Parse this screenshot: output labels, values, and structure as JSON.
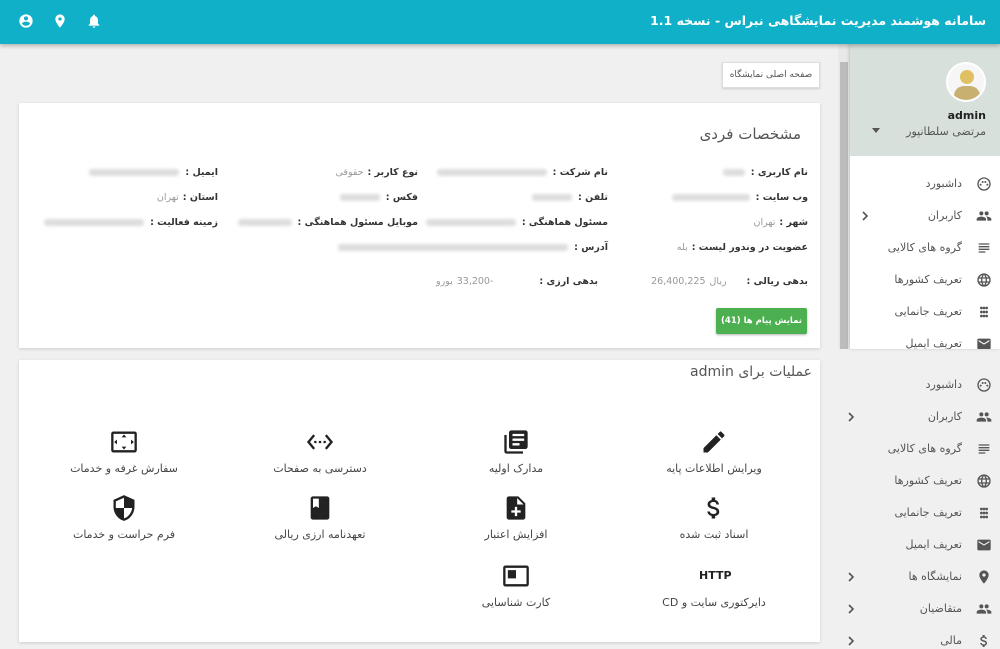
{
  "app": {
    "title": "سامانه هوشمند مدیریت نمایشگاهی نبراس - نسخه 1.1",
    "icons": [
      "account-circle-icon",
      "location-pin-icon",
      "bell-icon"
    ]
  },
  "profile": {
    "username": "admin",
    "fullname": "مرتضی سلطانپور"
  },
  "sidebar": {
    "items": [
      {
        "label": "داشبورد",
        "icon": "dashboard-icon"
      },
      {
        "label": "کاربران",
        "icon": "users-icon",
        "expandable": true
      },
      {
        "label": "گروه های کالایی",
        "icon": "list-icon"
      },
      {
        "label": "تعریف کشورها",
        "icon": "globe-icon"
      },
      {
        "label": "تعریف جانمایی",
        "icon": "grid-icon"
      },
      {
        "label": "تعریف ایمیل",
        "icon": "mail-icon"
      }
    ]
  },
  "sidebar2": {
    "items": [
      {
        "label": "داشبورد",
        "icon": "dashboard-icon"
      },
      {
        "label": "کاربران",
        "icon": "users-icon",
        "expandable": true
      },
      {
        "label": "گروه های کالایی",
        "icon": "list-icon"
      },
      {
        "label": "تعریف کشورها",
        "icon": "globe-icon"
      },
      {
        "label": "تعریف جانمایی",
        "icon": "grid-icon"
      },
      {
        "label": "تعریف ایمیل",
        "icon": "mail-icon"
      },
      {
        "label": "نمایشگاه ها",
        "icon": "location-pin-icon",
        "expandable": true
      },
      {
        "label": "متقاضیان",
        "icon": "users-icon",
        "expandable": true
      },
      {
        "label": "مالی",
        "icon": "dollar-icon",
        "expandable": true
      }
    ]
  },
  "home_button": "صفحه اصلی نمایشگاه",
  "profile_card": {
    "title": "مشخصات فردی",
    "fields": {
      "username_label": "نام کاربری :",
      "company_label": "نام شرکت :",
      "user_type_label": "نوع کاربر :",
      "user_type_value": "حقوقی",
      "email_label": "ایمیل :",
      "website_label": "وب سایت :",
      "phone_label": "تلفن :",
      "fax_label": "فکس :",
      "province_label": "استان :",
      "province_value": "تهران",
      "city_label": "شهر :",
      "city_value": "تهران",
      "coordinator_label": "مسئول هماهنگی :",
      "coordinator_mobile_label": "موبایل مسئول هماهنگی :",
      "activity_label": "زمینه فعالیت :",
      "vendor_label": "عضویت در وندور لیست :",
      "vendor_value": "بله",
      "address_label": "آدرس :",
      "rial_debt_label": "بدهی ریالی :",
      "rial_debt_value": "26,400,225",
      "rial_unit": "ریال",
      "currency_debt_label": "بدهی ارزی :",
      "currency_debt_value": "-33,200",
      "currency_unit": "یورو"
    },
    "messages_button": "نمایش پیام ها (41)"
  },
  "operations": {
    "title": "عملیات برای admin",
    "items": [
      {
        "label": "ویرایش اطلاعات پایه",
        "icon": "pencil-icon"
      },
      {
        "label": "مدارک اولیه",
        "icon": "library-books-icon"
      },
      {
        "label": "دسترسی به صفحات",
        "icon": "settings-ethernet-icon"
      },
      {
        "label": "سفارش غرفه و خدمات",
        "icon": "settings-overscan-icon"
      },
      {
        "label": "اسناد ثبت شده",
        "icon": "dollar-icon"
      },
      {
        "label": "افزایش اعتبار",
        "icon": "note-add-icon"
      },
      {
        "label": "تعهدنامه ارزی ریالی",
        "icon": "book-icon"
      },
      {
        "label": "فرم حراست و خدمات",
        "icon": "security-shield-icon"
      },
      {
        "label": "دایرکتوری سایت و CD",
        "icon": "http-icon",
        "icon_text": "HTTP"
      },
      {
        "label": "کارت شناسایی",
        "icon": "featured-video-icon"
      }
    ]
  }
}
